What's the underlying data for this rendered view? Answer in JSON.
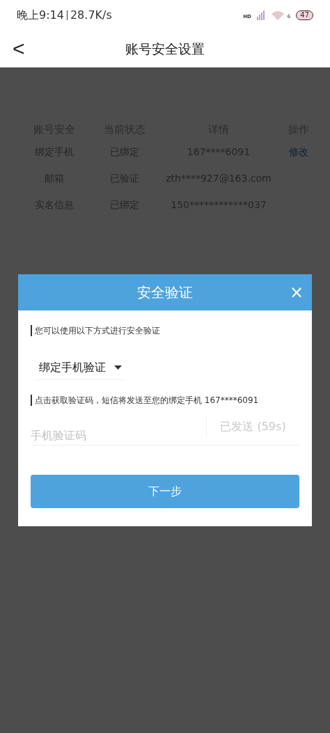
{
  "status_bar": {
    "time": "晚上9:14",
    "speed": "28.7K/s",
    "network": "HD",
    "wifi_badge": "6",
    "battery": "47"
  },
  "header": {
    "back": "<",
    "title": "账号安全设置"
  },
  "table": {
    "columns": [
      "账号安全",
      "当前状态",
      "详情",
      "操作"
    ],
    "rows": [
      {
        "item": "绑定手机",
        "status": "已绑定",
        "detail": "167****6091",
        "action": "修改"
      },
      {
        "item": "邮箱",
        "status": "已验证",
        "detail": "zth****927@163.com"
      },
      {
        "item": "实名信息",
        "status": "已绑定",
        "detail": "150************037"
      }
    ]
  },
  "dialog": {
    "title": "安全验证",
    "close": "×",
    "hint": "您可以使用以下方式进行安全验证",
    "method": "绑定手机验证",
    "sms_hint": "点击获取验证码，短信将发送至您的绑定手机 167****6091",
    "code_placeholder": "手机验证码",
    "send_button": {
      "label": "已发送 (59s)",
      "disabled": true
    },
    "next_button": "下一步"
  }
}
